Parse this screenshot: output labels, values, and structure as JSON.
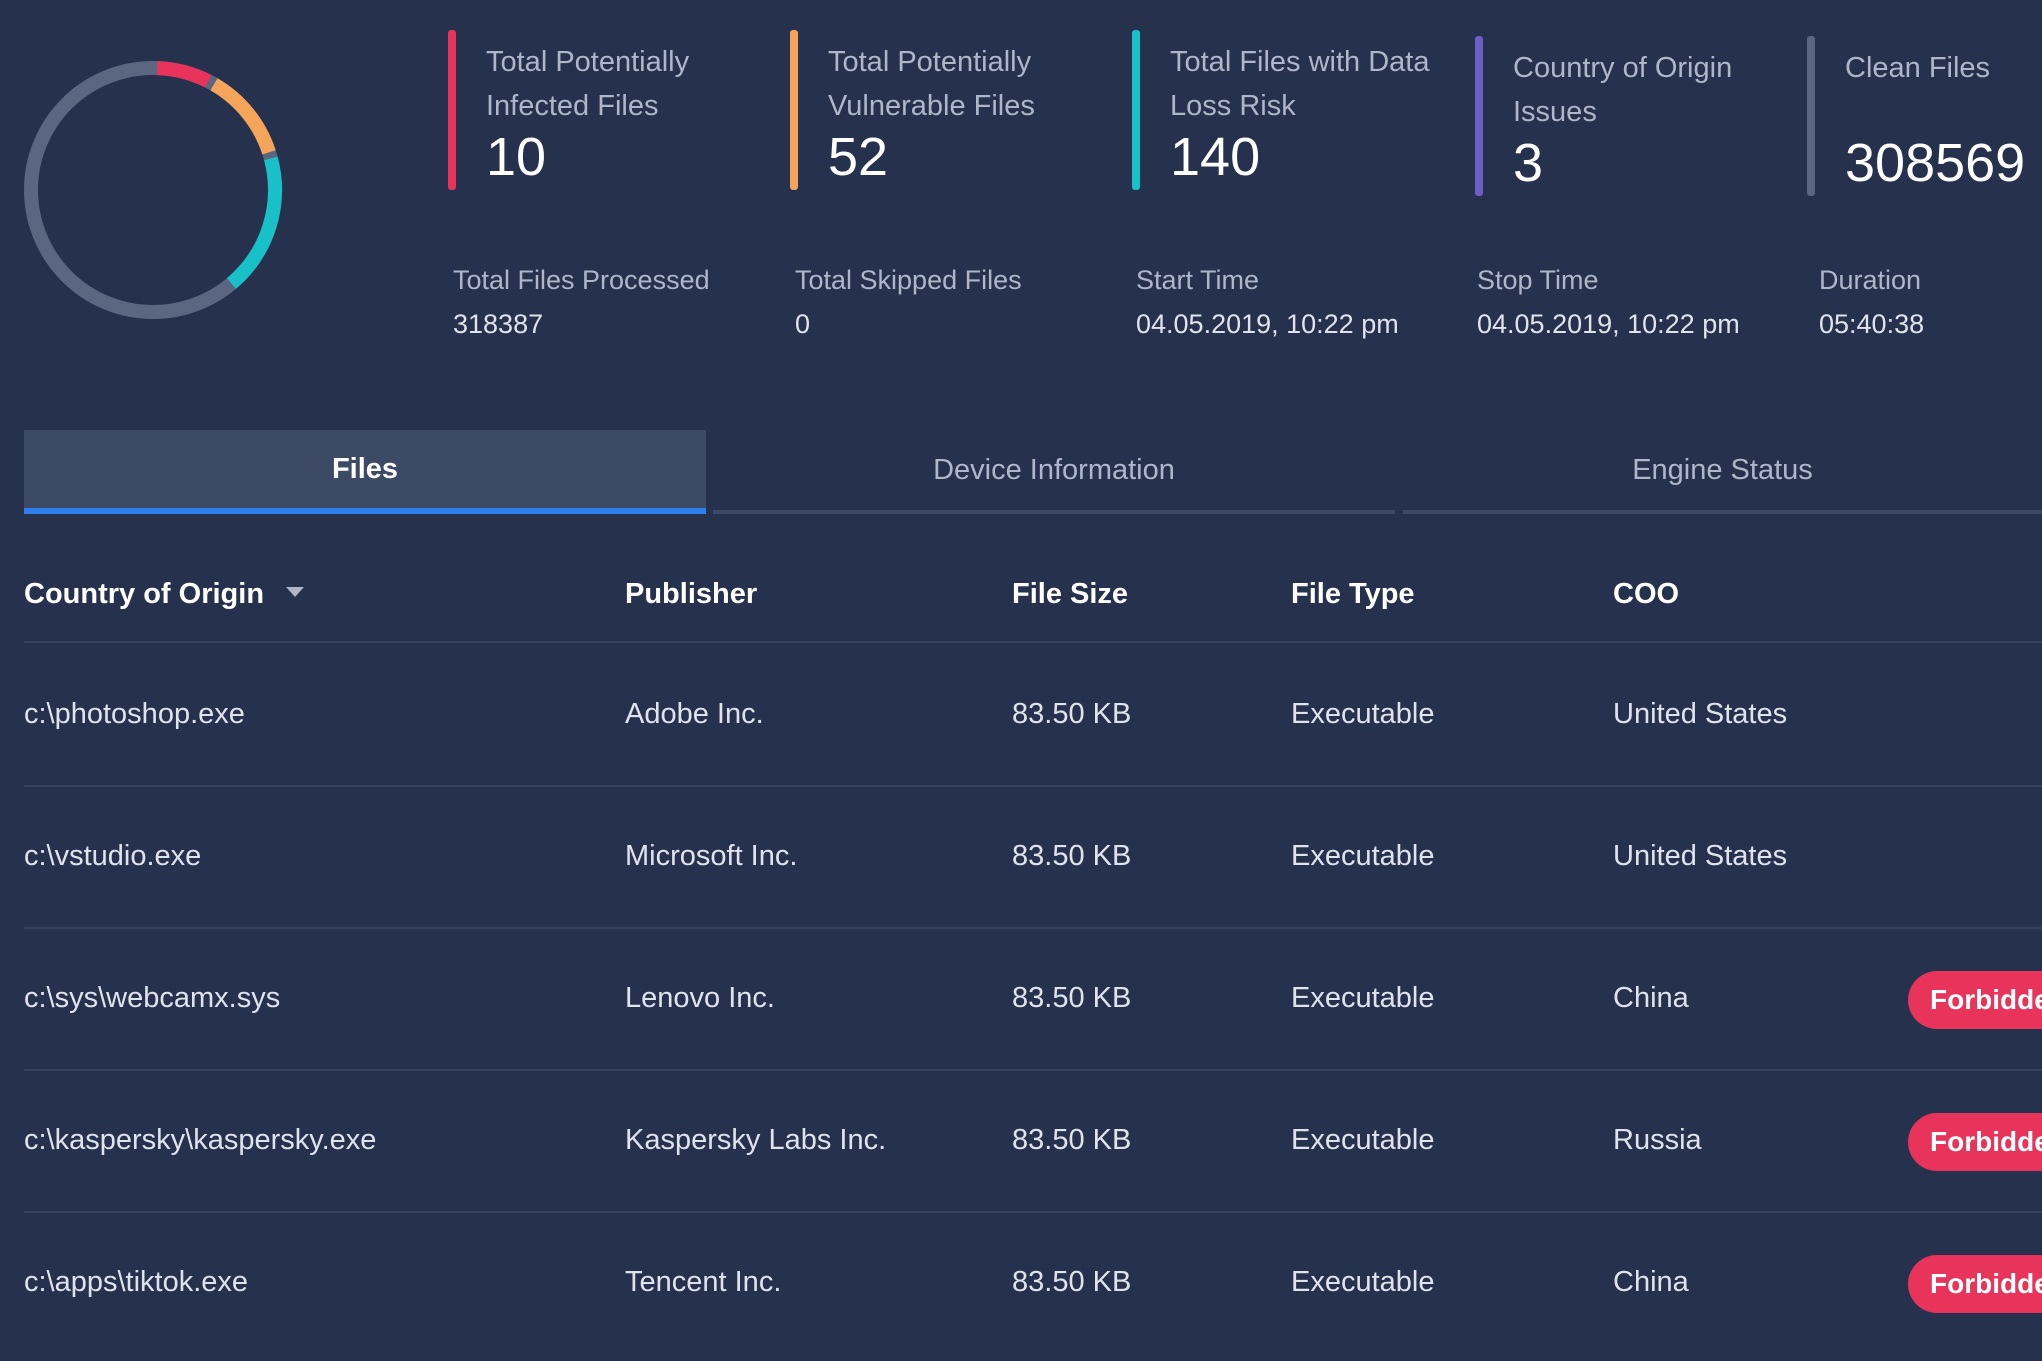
{
  "summary": {
    "stats": [
      {
        "label": "Total Potentially Infected Files",
        "value": "10",
        "color": "#e8335a"
      },
      {
        "label": "Total Potentially Vulnerable Files",
        "value": "52",
        "color": "#f5a55a"
      },
      {
        "label": "Total Files with Data Loss Risk",
        "value": "140",
        "color": "#18c0c8"
      },
      {
        "label": "Country of Origin Issues",
        "value": "3",
        "color": "#6b5fc4"
      },
      {
        "label": "Clean Files",
        "value": "308569",
        "color": "#5b6680"
      }
    ],
    "meta": [
      {
        "label": "Total Files Processed",
        "value": "318387"
      },
      {
        "label": "Total Skipped Files",
        "value": "0"
      },
      {
        "label": "Start Time",
        "value": "04.05.2019, 10:22 pm"
      },
      {
        "label": "Stop Time",
        "value": "04.05.2019, 10:22 pm"
      },
      {
        "label": "Duration",
        "value": "05:40:38"
      }
    ]
  },
  "tabs": [
    {
      "label": "Files",
      "active": true
    },
    {
      "label": "Device Information",
      "active": false
    },
    {
      "label": "Engine Status",
      "active": false
    }
  ],
  "table": {
    "columns": [
      "Country of Origin",
      "Publisher",
      "File Size",
      "File Type",
      "COO"
    ],
    "rows": [
      {
        "path": "c:\\photoshop.exe",
        "publisher": "Adobe Inc.",
        "size": "83.50 KB",
        "type": "Executable",
        "coo": "United States",
        "badge": ""
      },
      {
        "path": "c:\\vstudio.exe",
        "publisher": "Microsoft Inc.",
        "size": "83.50 KB",
        "type": "Executable",
        "coo": "United States",
        "badge": ""
      },
      {
        "path": "c:\\sys\\webcamx.sys",
        "publisher": "Lenovo Inc.",
        "size": "83.50 KB",
        "type": "Executable",
        "coo": "China",
        "badge": "Forbidde"
      },
      {
        "path": "c:\\kaspersky\\kaspersky.exe",
        "publisher": "Kaspersky Labs Inc.",
        "size": "83.50 KB",
        "type": "Executable",
        "coo": "Russia",
        "badge": "Forbidde"
      },
      {
        "path": "c:\\apps\\tiktok.exe",
        "publisher": "Tencent Inc.",
        "size": "83.50 KB",
        "type": "Executable",
        "coo": "China",
        "badge": "Forbidde"
      }
    ]
  },
  "colors": {
    "background": "#26314d",
    "accent_tab": "#2f7ff0",
    "badge": "#e8335a"
  }
}
